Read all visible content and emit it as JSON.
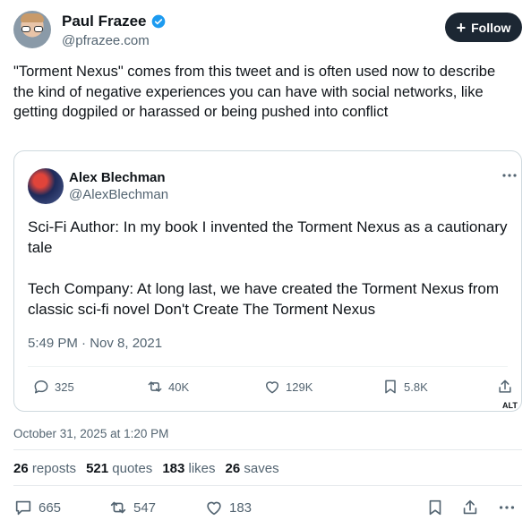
{
  "post": {
    "author_name": "Paul Frazee",
    "author_handle": "@pfrazee.com",
    "follow_label": "Follow",
    "text": "\"Torment Nexus\" comes from this tweet and is often used now to describe the kind of negative experiences you can have with social networks, like getting dogpiled or harassed or being pushed into conflict",
    "timestamp": "October 31, 2025 at 1:20 PM"
  },
  "quote": {
    "author_name": "Alex Blechman",
    "author_handle": "@AlexBlechman",
    "text": "Sci-Fi Author: In my book I invented the Torment Nexus as a cautionary tale\n\nTech Company: At long last, we have created the Torment Nexus from classic sci-fi novel Don't Create The Torment Nexus",
    "timestamp": "5:49 PM · Nov 8, 2021",
    "replies": "325",
    "retweets": "40K",
    "likes": "129K",
    "bookmarks": "5.8K",
    "alt_label": "ALT"
  },
  "stats": {
    "reposts_count": "26",
    "reposts_label": "reposts",
    "quotes_count": "521",
    "quotes_label": "quotes",
    "likes_count": "183",
    "likes_label": "likes",
    "saves_count": "26",
    "saves_label": "saves"
  },
  "actions": {
    "replies": "665",
    "reposts": "547",
    "likes": "183"
  },
  "colors": {
    "follow_bg": "#1c2733",
    "verified": "#1d9bf0",
    "muted": "#536471"
  },
  "icons": [
    "verified-icon",
    "plus-icon",
    "more-icon",
    "reply-icon",
    "retweet-icon",
    "like-icon",
    "bookmark-icon",
    "share-icon"
  ]
}
